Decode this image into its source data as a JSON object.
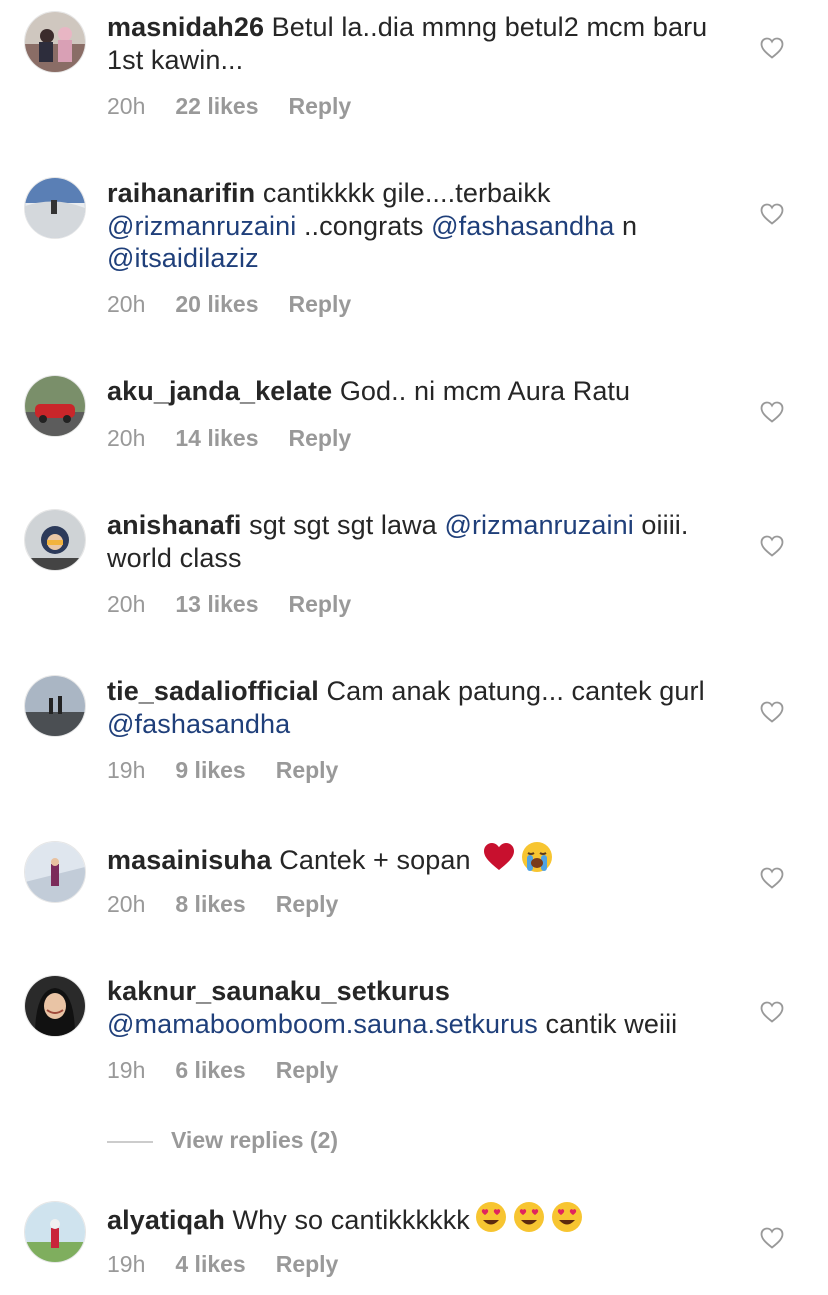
{
  "comments": [
    {
      "username": "masnidah26",
      "text": " Betul la..dia mmng betul2 mcm baru 1st kawin...",
      "time": "20h",
      "likes": "22 likes",
      "reply": "Reply"
    },
    {
      "username": "raihanarifin",
      "text_a": " cantikkkk gile....terbaikk ",
      "mention_a": "@rizmanruzaini",
      "text_b": " ..congrats ",
      "mention_b": "@fashasandha",
      "text_c": "  n ",
      "mention_c": "@itsaidilaziz",
      "time": "20h",
      "likes": "20 likes",
      "reply": "Reply"
    },
    {
      "username": "aku_janda_kelate",
      "text": " God.. ni mcm Aura Ratu",
      "time": "20h",
      "likes": "14 likes",
      "reply": "Reply"
    },
    {
      "username": "anishanafi",
      "text_a": " sgt sgt sgt lawa ",
      "mention_a": "@rizmanruzaini",
      "text_b": " oiiii. world class",
      "time": "20h",
      "likes": "13 likes",
      "reply": "Reply"
    },
    {
      "username": "tie_sadaliofficial",
      "text_a": " Cam anak patung... cantek gurl ",
      "mention_a": "@fashasandha",
      "time": "19h",
      "likes": "9 likes",
      "reply": "Reply"
    },
    {
      "username": "masainisuha",
      "text": " Cantek + sopan ",
      "emojis": [
        "red-heart",
        "loudly-crying-face"
      ],
      "time": "20h",
      "likes": "8 likes",
      "reply": "Reply"
    },
    {
      "username": "kaknur_saunaku_setkurus",
      "mention_a": "@mamaboomboom.sauna.setkurus",
      "text_b": " cantik weiii",
      "time": "19h",
      "likes": "6 likes",
      "reply": "Reply"
    },
    {
      "username": "alyatiqah",
      "text": " Why so cantikkkkkk",
      "emojis": [
        "heart-eyes-face",
        "heart-eyes-face",
        "heart-eyes-face"
      ],
      "time": "19h",
      "likes": "4 likes",
      "reply": "Reply"
    }
  ],
  "view_replies": "View replies (2)",
  "colors": {
    "mention": "#1f3f7a",
    "meta": "#999999",
    "text": "#262626"
  }
}
